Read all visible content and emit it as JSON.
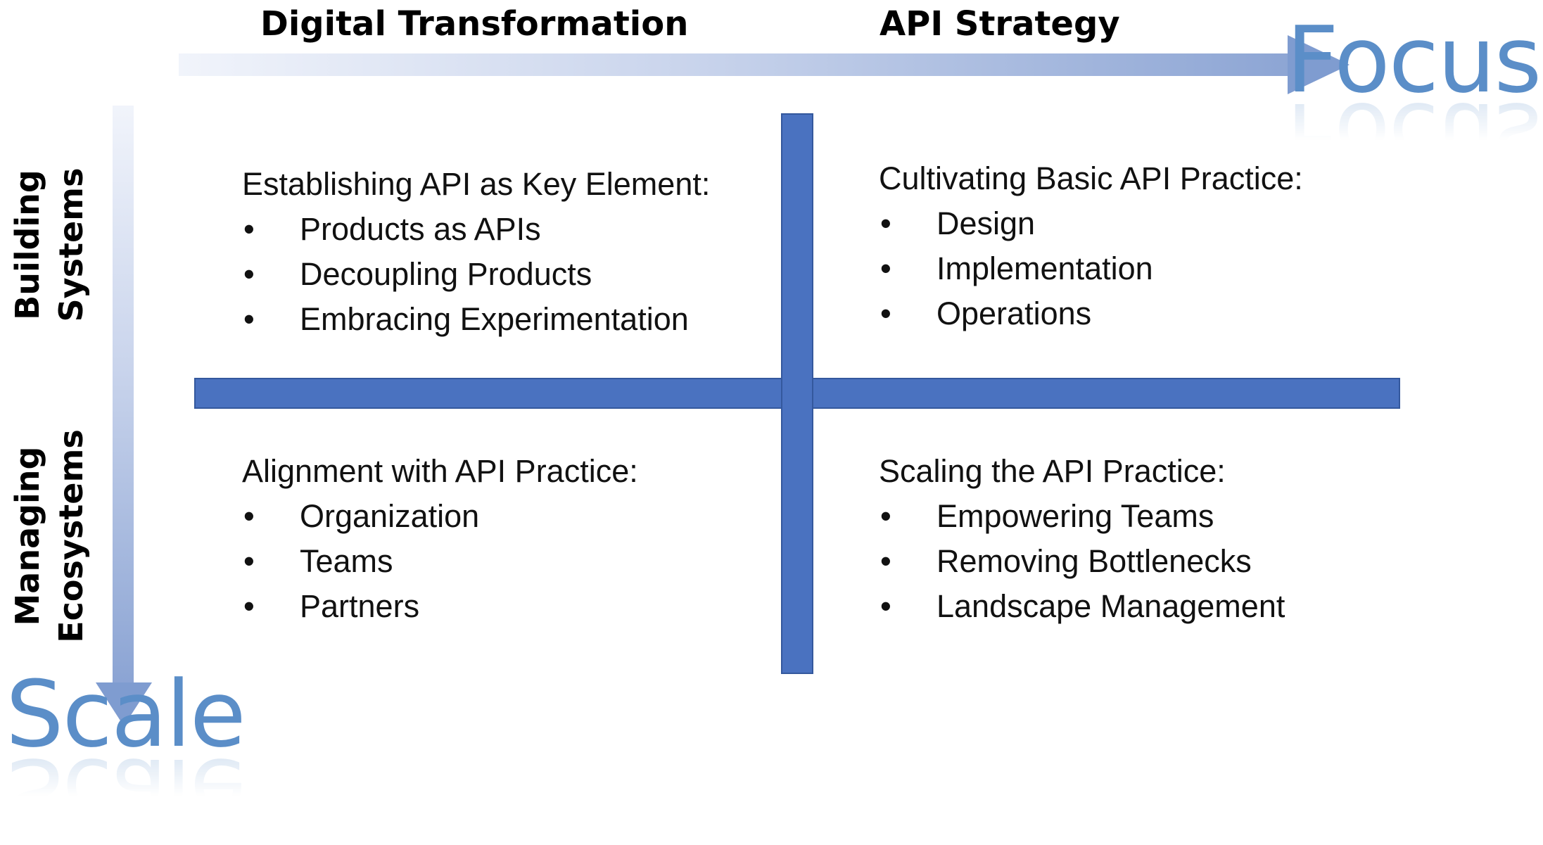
{
  "columns": [
    "Digital Transformation",
    "API Strategy"
  ],
  "rows": [
    {
      "line1": "Building",
      "line2": "Systems"
    },
    {
      "line1": "Managing",
      "line2": "Ecosystems"
    }
  ],
  "axes": {
    "horizontal": "Focus",
    "vertical": "Scale"
  },
  "bullet": "•",
  "quadrants": [
    {
      "title": "Establishing API as Key Element:",
      "items": [
        "Products as APIs",
        "Decoupling Products",
        "Embracing Experimentation"
      ]
    },
    {
      "title": "Cultivating Basic API Practice:",
      "items": [
        "Design",
        "Implementation",
        "Operations"
      ]
    },
    {
      "title": "Alignment with API Practice:",
      "items": [
        "Organization",
        "Teams",
        "Partners"
      ]
    },
    {
      "title": "Scaling the API Practice:",
      "items": [
        "Empowering Teams",
        "Removing Bottlenecks",
        "Landscape Management"
      ]
    }
  ],
  "colors": {
    "cross": "#4a72c0",
    "axis_text": "#5b8ec8",
    "arrow": "#8aa3d3"
  }
}
